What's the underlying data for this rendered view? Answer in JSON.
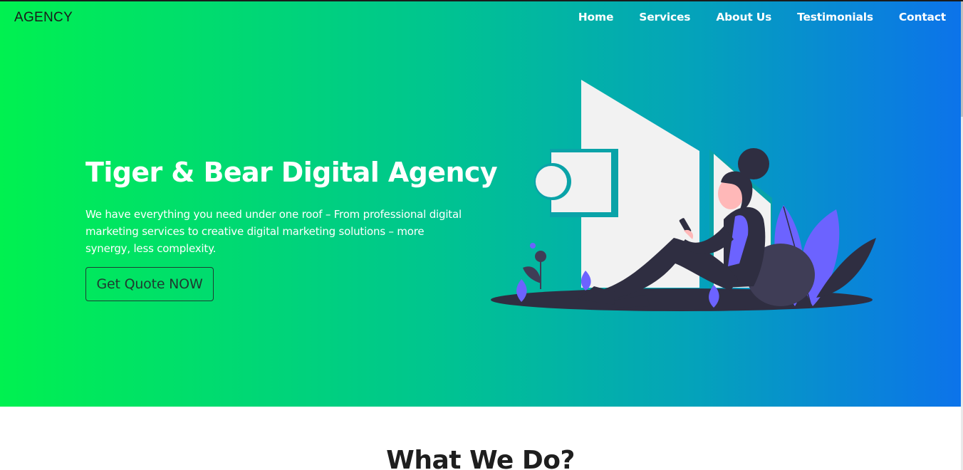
{
  "header": {
    "brand": "AGENCY",
    "nav": [
      "Home",
      "Services",
      "About Us",
      "Testimonials",
      "Contact"
    ]
  },
  "hero": {
    "title": "Tiger & Bear Digital Agency",
    "description": "We have everything you need under one roof – From professional digital marketing services to creative digital marketing solutions – more synergy, less complexity.",
    "cta_label": "Get Quote NOW",
    "illustration": "woman-with-phone-illustration"
  },
  "section": {
    "title": "What We Do?"
  },
  "colors": {
    "gradient_start": "#00f150",
    "gradient_end": "#0c73ea",
    "text_light": "#ffffff",
    "illustration_purple": "#6c63ff",
    "illustration_dark": "#2f2e41"
  }
}
